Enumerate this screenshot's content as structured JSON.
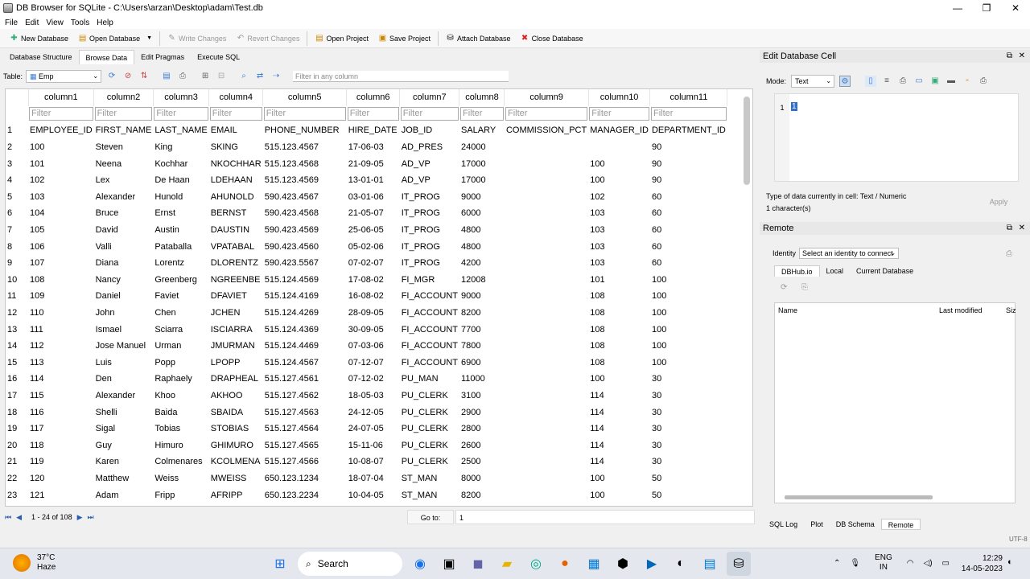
{
  "window": {
    "title": "DB Browser for SQLite - C:\\Users\\arzan\\Desktop\\adam\\Test.db",
    "controls": [
      "—",
      "❐",
      "✕"
    ]
  },
  "menu": [
    "File",
    "Edit",
    "View",
    "Tools",
    "Help"
  ],
  "toolbar": {
    "new_db": "New Database",
    "open_db": "Open Database",
    "write": "Write Changes",
    "revert": "Revert Changes",
    "open_project": "Open Project",
    "save_project": "Save Project",
    "attach": "Attach Database",
    "close": "Close Database"
  },
  "tabs": [
    "Database Structure",
    "Browse Data",
    "Edit Pragmas",
    "Execute SQL"
  ],
  "browse": {
    "table_label": "Table:",
    "table_value": "Emp",
    "filter_any_placeholder": "Filter in any column",
    "filter_placeholder": "Filter",
    "columns": [
      "column1",
      "column2",
      "column3",
      "column4",
      "column5",
      "column6",
      "column7",
      "column8",
      "column9",
      "column10",
      "column11"
    ],
    "rows": [
      [
        "1",
        "EMPLOYEE_ID",
        "FIRST_NAME",
        "LAST_NAME",
        "EMAIL",
        "PHONE_NUMBER",
        "HIRE_DATE",
        "JOB_ID",
        "SALARY",
        "COMMISSION_PCT",
        "MANAGER_ID",
        "DEPARTMENT_ID"
      ],
      [
        "2",
        "100",
        "Steven",
        "King",
        "SKING",
        "515.123.4567",
        "17-06-03",
        "AD_PRES",
        "24000",
        "",
        "",
        "90"
      ],
      [
        "3",
        "101",
        "Neena",
        "Kochhar",
        "NKOCHHAR",
        "515.123.4568",
        "21-09-05",
        "AD_VP",
        "17000",
        "",
        "100",
        "90"
      ],
      [
        "4",
        "102",
        "Lex",
        "De Haan",
        "LDEHAAN",
        "515.123.4569",
        "13-01-01",
        "AD_VP",
        "17000",
        "",
        "100",
        "90"
      ],
      [
        "5",
        "103",
        "Alexander",
        "Hunold",
        "AHUNOLD",
        "590.423.4567",
        "03-01-06",
        "IT_PROG",
        "9000",
        "",
        "102",
        "60"
      ],
      [
        "6",
        "104",
        "Bruce",
        "Ernst",
        "BERNST",
        "590.423.4568",
        "21-05-07",
        "IT_PROG",
        "6000",
        "",
        "103",
        "60"
      ],
      [
        "7",
        "105",
        "David",
        "Austin",
        "DAUSTIN",
        "590.423.4569",
        "25-06-05",
        "IT_PROG",
        "4800",
        "",
        "103",
        "60"
      ],
      [
        "8",
        "106",
        "Valli",
        "Pataballa",
        "VPATABAL",
        "590.423.4560",
        "05-02-06",
        "IT_PROG",
        "4800",
        "",
        "103",
        "60"
      ],
      [
        "9",
        "107",
        "Diana",
        "Lorentz",
        "DLORENTZ",
        "590.423.5567",
        "07-02-07",
        "IT_PROG",
        "4200",
        "",
        "103",
        "60"
      ],
      [
        "10",
        "108",
        "Nancy",
        "Greenberg",
        "NGREENBE",
        "515.124.4569",
        "17-08-02",
        "FI_MGR",
        "12008",
        "",
        "101",
        "100"
      ],
      [
        "11",
        "109",
        "Daniel",
        "Faviet",
        "DFAVIET",
        "515.124.4169",
        "16-08-02",
        "FI_ACCOUNT",
        "9000",
        "",
        "108",
        "100"
      ],
      [
        "12",
        "110",
        "John",
        "Chen",
        "JCHEN",
        "515.124.4269",
        "28-09-05",
        "FI_ACCOUNT",
        "8200",
        "",
        "108",
        "100"
      ],
      [
        "13",
        "111",
        "Ismael",
        "Sciarra",
        "ISCIARRA",
        "515.124.4369",
        "30-09-05",
        "FI_ACCOUNT",
        "7700",
        "",
        "108",
        "100"
      ],
      [
        "14",
        "112",
        "Jose Manuel",
        "Urman",
        "JMURMAN",
        "515.124.4469",
        "07-03-06",
        "FI_ACCOUNT",
        "7800",
        "",
        "108",
        "100"
      ],
      [
        "15",
        "113",
        "Luis",
        "Popp",
        "LPOPP",
        "515.124.4567",
        "07-12-07",
        "FI_ACCOUNT",
        "6900",
        "",
        "108",
        "100"
      ],
      [
        "16",
        "114",
        "Den",
        "Raphaely",
        "DRAPHEAL",
        "515.127.4561",
        "07-12-02",
        "PU_MAN",
        "11000",
        "",
        "100",
        "30"
      ],
      [
        "17",
        "115",
        "Alexander",
        "Khoo",
        "AKHOO",
        "515.127.4562",
        "18-05-03",
        "PU_CLERK",
        "3100",
        "",
        "114",
        "30"
      ],
      [
        "18",
        "116",
        "Shelli",
        "Baida",
        "SBAIDA",
        "515.127.4563",
        "24-12-05",
        "PU_CLERK",
        "2900",
        "",
        "114",
        "30"
      ],
      [
        "19",
        "117",
        "Sigal",
        "Tobias",
        "STOBIAS",
        "515.127.4564",
        "24-07-05",
        "PU_CLERK",
        "2800",
        "",
        "114",
        "30"
      ],
      [
        "20",
        "118",
        "Guy",
        "Himuro",
        "GHIMURO",
        "515.127.4565",
        "15-11-06",
        "PU_CLERK",
        "2600",
        "",
        "114",
        "30"
      ],
      [
        "21",
        "119",
        "Karen",
        "Colmenares",
        "KCOLMENA",
        "515.127.4566",
        "10-08-07",
        "PU_CLERK",
        "2500",
        "",
        "114",
        "30"
      ],
      [
        "22",
        "120",
        "Matthew",
        "Weiss",
        "MWEISS",
        "650.123.1234",
        "18-07-04",
        "ST_MAN",
        "8000",
        "",
        "100",
        "50"
      ],
      [
        "23",
        "121",
        "Adam",
        "Fripp",
        "AFRIPP",
        "650.123.2234",
        "10-04-05",
        "ST_MAN",
        "8200",
        "",
        "100",
        "50"
      ]
    ],
    "nav_count": "1 - 24 of 108",
    "goto_label": "Go to:",
    "goto_value": "1"
  },
  "edit_cell": {
    "title": "Edit Database Cell",
    "mode_label": "Mode:",
    "mode_value": "Text",
    "line_no": "1",
    "content": "1",
    "type_text": "Type of data currently in cell: Text / Numeric",
    "size_text": "1 character(s)",
    "apply": "Apply"
  },
  "remote": {
    "title": "Remote",
    "identity_label": "Identity",
    "identity_value": "Select an identity to connect",
    "tabs": [
      "DBHub.io",
      "Local",
      "Current Database"
    ],
    "col_name": "Name",
    "col_modified": "Last modified",
    "col_size": "Siz"
  },
  "bottom_tabs": [
    "SQL Log",
    "Plot",
    "DB Schema",
    "Remote"
  ],
  "encoding": "UTF-8",
  "taskbar": {
    "temp": "37°C",
    "weather": "Haze",
    "search": "Search",
    "lang1": "ENG",
    "lang2": "IN",
    "time": "12:29",
    "date": "14-05-2023"
  }
}
